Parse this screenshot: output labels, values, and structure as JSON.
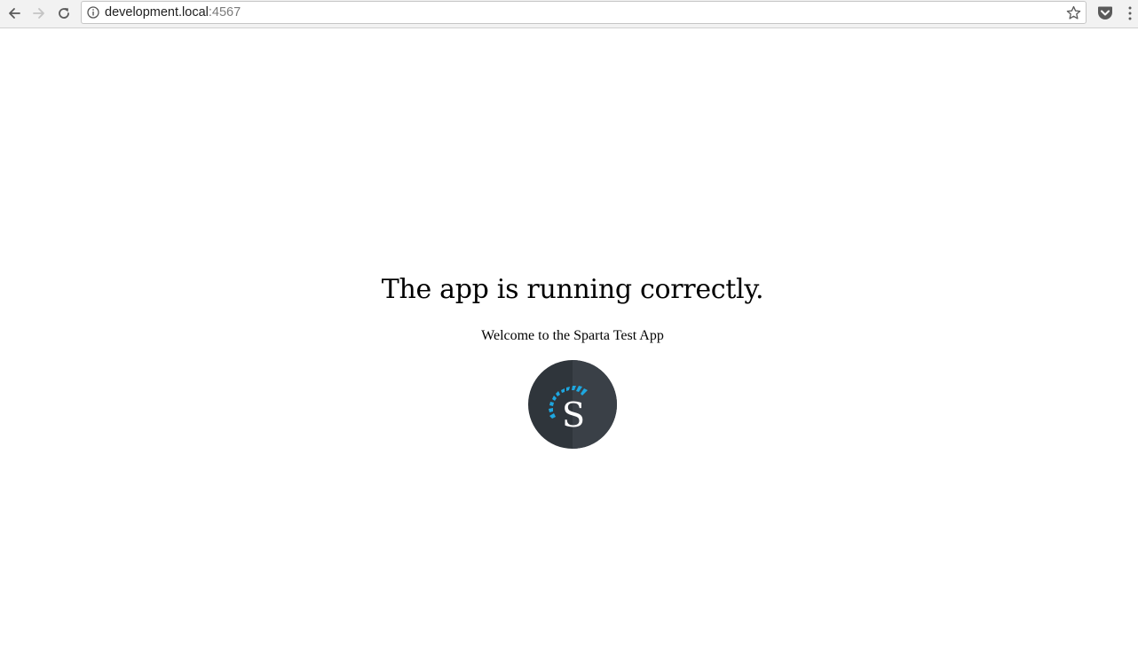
{
  "browser": {
    "url_host": "development.local",
    "url_port": ":4567",
    "icons": {
      "back": "arrow-left-icon",
      "forward": "arrow-right-icon",
      "reload": "reload-icon",
      "site_info": "info-icon",
      "bookmark": "star-icon",
      "pocket": "pocket-icon",
      "menu": "kebab-menu-icon"
    }
  },
  "page": {
    "heading": "The app is running correctly.",
    "subtitle": "Welcome to the Sparta Test App",
    "logo": {
      "letter": "S",
      "colors": {
        "circle_dark": "#2f353b",
        "circle_light": "#3a4047",
        "accent": "#1ea7e0",
        "letter": "#ffffff"
      }
    }
  }
}
